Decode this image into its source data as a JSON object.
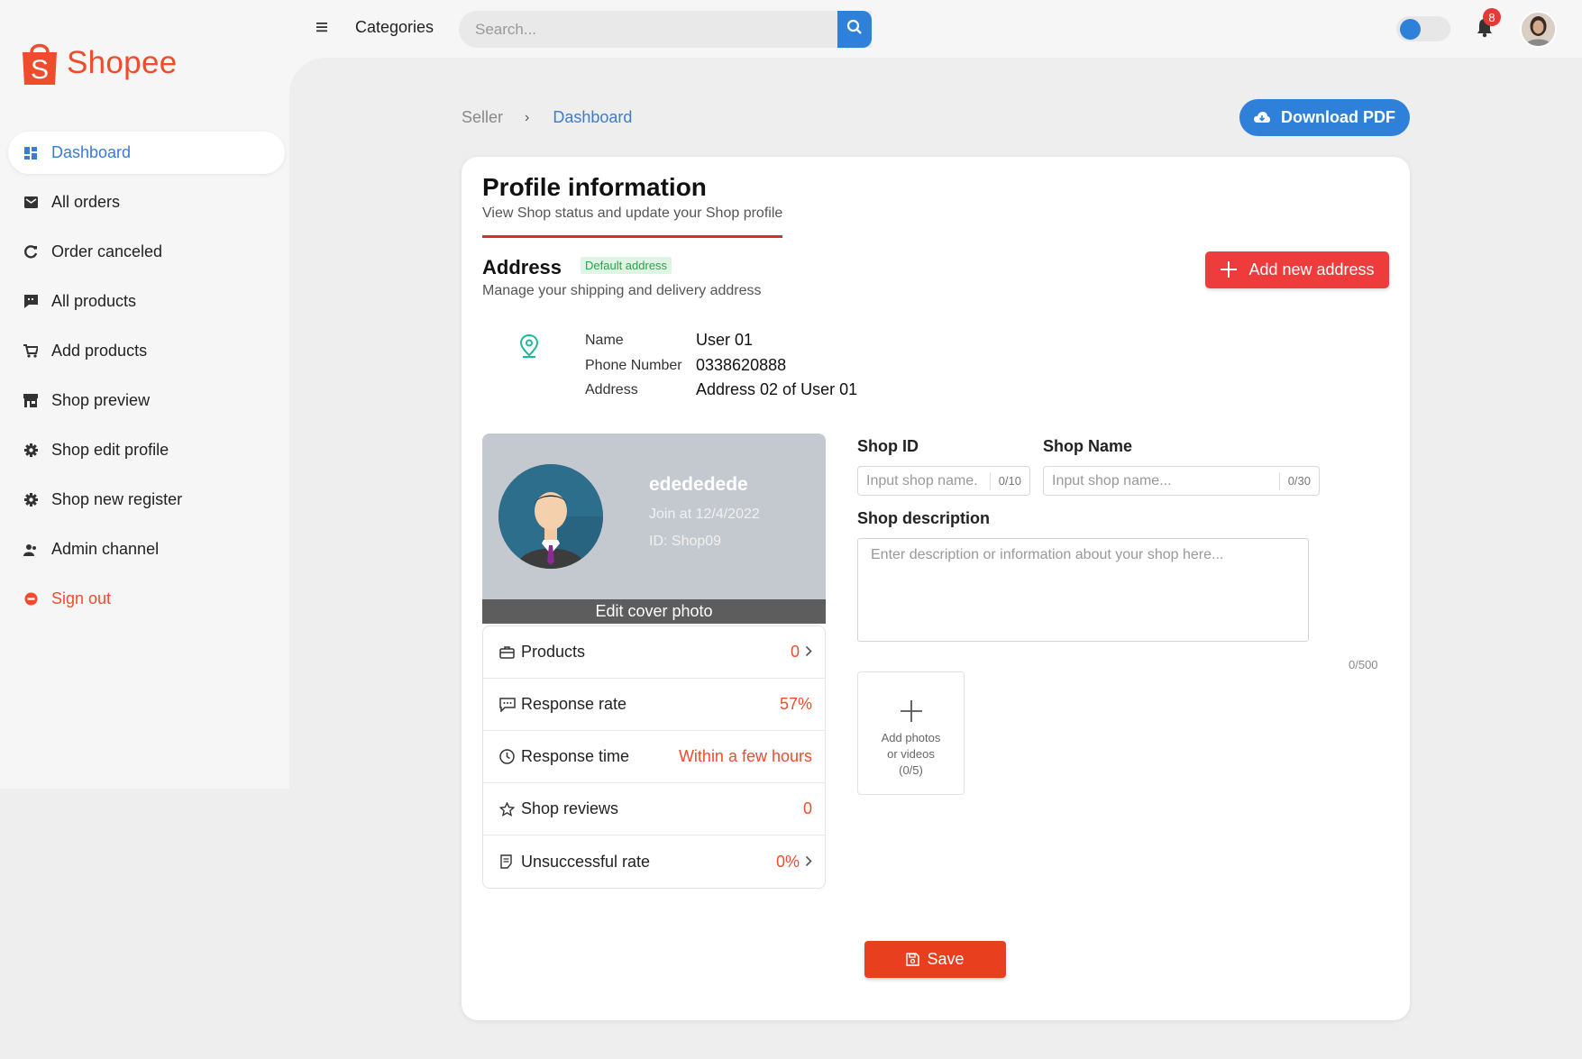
{
  "brand": {
    "name": "Shopee",
    "color": "#ee4d2d"
  },
  "sidebar": {
    "items": [
      {
        "label": "Dashboard",
        "icon": "dashboard-icon"
      },
      {
        "label": "All orders",
        "icon": "mail-icon"
      },
      {
        "label": "Order canceled",
        "icon": "refresh-icon"
      },
      {
        "label": "All products",
        "icon": "chat-icon"
      },
      {
        "label": "Add products",
        "icon": "cart-icon"
      },
      {
        "label": "Shop preview",
        "icon": "store-icon"
      },
      {
        "label": "Shop edit profile",
        "icon": "gear-icon"
      },
      {
        "label": "Shop new register",
        "icon": "gear-icon"
      },
      {
        "label": "Admin channel",
        "icon": "users-icon"
      },
      {
        "label": "Sign out",
        "icon": "minus-circle-icon"
      }
    ]
  },
  "header": {
    "categories_label": "Categories",
    "search_placeholder": "Search...",
    "notification_count": "8",
    "accent": "#2f80d8"
  },
  "breadcrumb": {
    "root": "Seller",
    "separator": "›",
    "current": "Dashboard"
  },
  "download_label": "Download PDF",
  "profile": {
    "title": "Profile information",
    "subtitle": "View Shop status and update your Shop profile"
  },
  "address": {
    "title": "Address",
    "badge": "Default address",
    "subtitle": "Manage your shipping and delivery address",
    "add_button": "Add new address",
    "labels": {
      "name": "Name",
      "phone": "Phone Number",
      "address": "Address"
    },
    "values": {
      "name": "User 01",
      "phone": "0338620888",
      "address": "Address 02 of User 01"
    }
  },
  "shop_card": {
    "name": "edededede",
    "join": "Join at 12/4/2022",
    "id": "ID: Shop09",
    "edit_cover": "Edit cover photo"
  },
  "stats": [
    {
      "label": "Products",
      "value": "0",
      "icon": "briefcase-icon",
      "chevron": true
    },
    {
      "label": "Response rate",
      "value": "57%",
      "icon": "message-icon",
      "chevron": false
    },
    {
      "label": "Response time",
      "value": "Within a few hours",
      "icon": "clock-icon",
      "chevron": false
    },
    {
      "label": "Shop reviews",
      "value": "0",
      "icon": "star-icon",
      "chevron": false
    },
    {
      "label": "Unsuccessful rate",
      "value": "0%",
      "icon": "document-icon",
      "chevron": true
    }
  ],
  "form": {
    "shop_id_label": "Shop ID",
    "shop_id_placeholder": "Input shop name.",
    "shop_id_count": "0/10",
    "shop_name_label": "Shop Name",
    "shop_name_placeholder": "Input shop name...",
    "shop_name_count": "0/30",
    "desc_label": "Shop description",
    "desc_placeholder": "Enter description or information about your shop here...",
    "desc_count": "0/500",
    "upload_text": "Add photos or videos (0/5)",
    "save_label": "Save"
  }
}
